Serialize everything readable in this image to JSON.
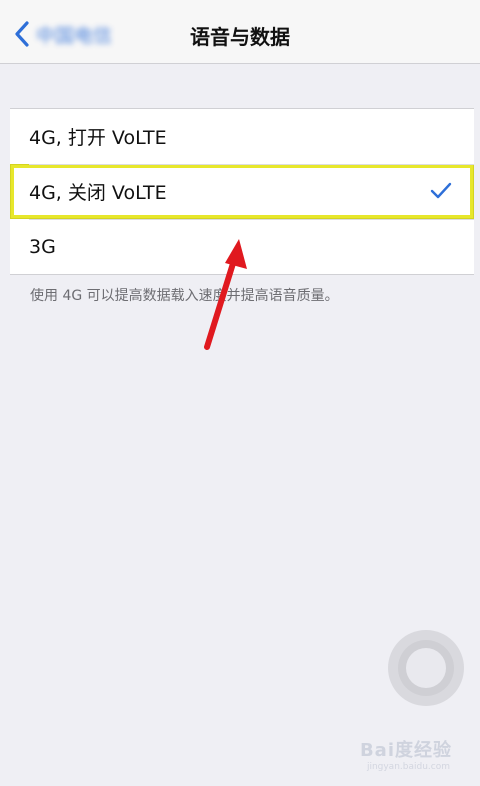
{
  "navbar": {
    "back_label": "中国电信",
    "title": "语音与数据"
  },
  "options": [
    {
      "label": "4G, 打开 VoLTE",
      "selected": false
    },
    {
      "label": "4G, 关闭 VoLTE",
      "selected": true
    },
    {
      "label": "3G",
      "selected": false
    }
  ],
  "footer_note": "使用 4G 可以提高数据载入速度并提高语音质量。",
  "watermark": {
    "text": "Bai度经验",
    "subtext": "jingyan.baidu.com"
  },
  "colors": {
    "accent": "#2e6fd8",
    "highlight_box": "#e7e72b",
    "annotation_arrow": "#e0191f"
  }
}
